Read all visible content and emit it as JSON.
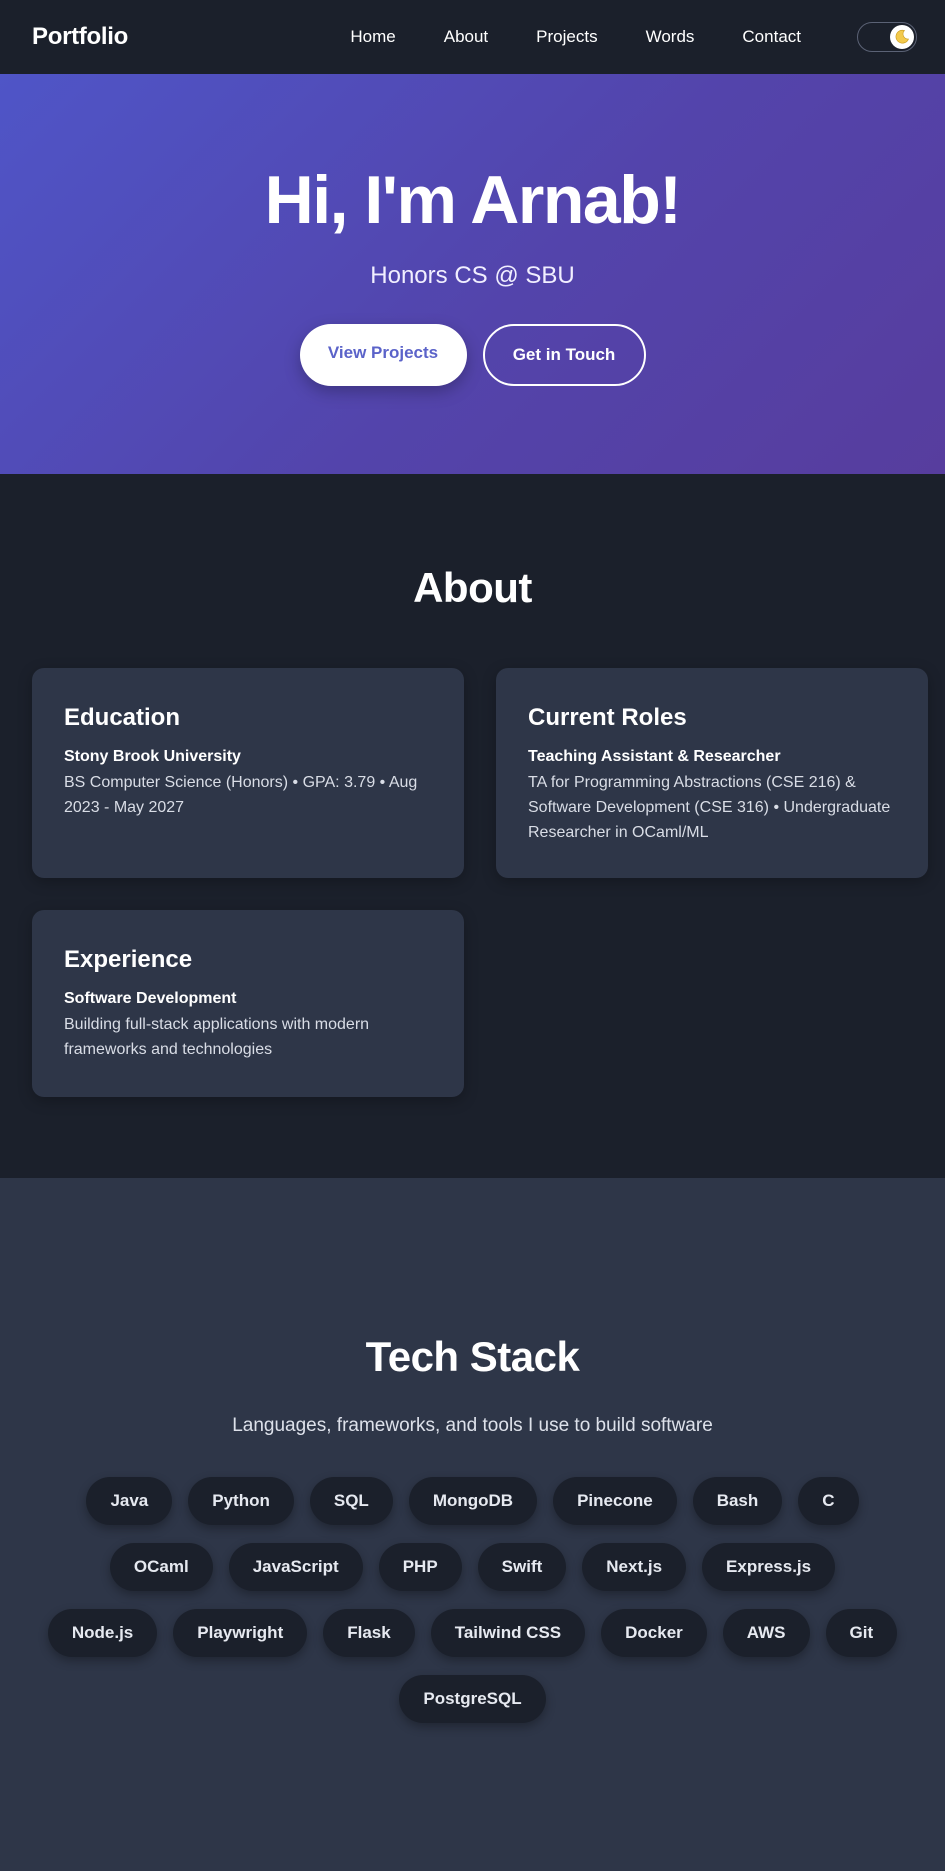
{
  "nav": {
    "brand": "Portfolio",
    "links": [
      "Home",
      "About",
      "Projects",
      "Words",
      "Contact"
    ],
    "theme_toggle_icon": "moon-icon"
  },
  "hero": {
    "title": "Hi, I'm Arnab!",
    "subtitle": "Honors CS @ SBU",
    "primary_button": "View Projects",
    "secondary_button": "Get in Touch"
  },
  "about": {
    "title": "About",
    "cards": [
      {
        "title": "Education",
        "subtitle": "Stony Brook University",
        "text": "BS Computer Science (Honors) • GPA: 3.79 • Aug 2023 - May 2027"
      },
      {
        "title": "Current Roles",
        "subtitle": "Teaching Assistant & Researcher",
        "text": "TA for Programming Abstractions (CSE 216) & Software Development (CSE 316) • Undergraduate Researcher in OCaml/ML"
      },
      {
        "title": "Experience",
        "subtitle": "Software Development",
        "text": "Building full-stack applications with modern frameworks and technologies"
      }
    ]
  },
  "tech": {
    "title": "Tech Stack",
    "subtitle": "Languages, frameworks, and tools I use to build software",
    "chips": [
      "Java",
      "Python",
      "SQL",
      "MongoDB",
      "Pinecone",
      "Bash",
      "C",
      "OCaml",
      "JavaScript",
      "PHP",
      "Swift",
      "Next.js",
      "Express.js",
      "Node.js",
      "Playwright",
      "Flask",
      "Tailwind CSS",
      "Docker",
      "AWS",
      "Git",
      "PostgreSQL"
    ]
  },
  "colors": {
    "accent": "#5b63c9",
    "background": "#1b202b",
    "card": "#2e3648"
  }
}
